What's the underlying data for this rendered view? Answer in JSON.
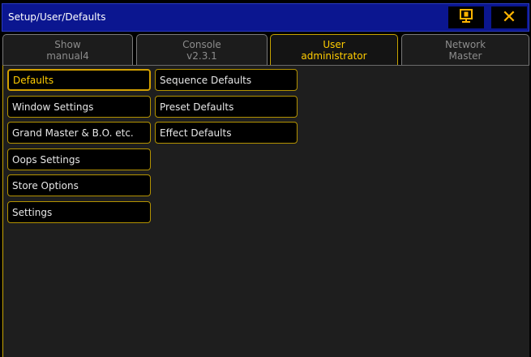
{
  "window": {
    "title": "Setup/User/Defaults"
  },
  "titlebar_buttons": {
    "help_icon": "help-screen-icon",
    "close_label": "✕"
  },
  "tabs": [
    {
      "line1": "Show",
      "line2": "manual4",
      "active": false
    },
    {
      "line1": "Console",
      "line2": "v2.3.1",
      "active": false
    },
    {
      "line1": "User",
      "line2": "administrator",
      "active": true
    },
    {
      "line1": "Network",
      "line2": "Master",
      "active": false
    }
  ],
  "left_menu": [
    {
      "label": "Defaults",
      "active": true
    },
    {
      "label": "Window Settings",
      "active": false
    },
    {
      "label": "Grand Master & B.O. etc.",
      "active": false
    },
    {
      "label": "Oops Settings",
      "active": false
    },
    {
      "label": "Store Options",
      "active": false
    },
    {
      "label": "Settings",
      "active": false
    }
  ],
  "defaults_menu": [
    {
      "label": "Sequence Defaults"
    },
    {
      "label": "Preset Defaults"
    },
    {
      "label": "Effect Defaults"
    }
  ],
  "colors": {
    "titlebar": "#0b1690",
    "accent": "#ffcc00",
    "border": "#b39200",
    "panel": "#1e1e1e"
  }
}
